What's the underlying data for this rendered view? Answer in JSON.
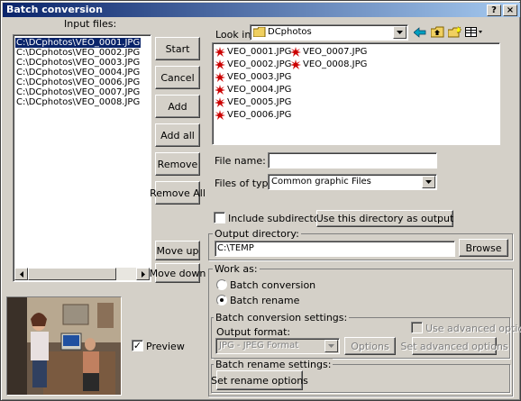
{
  "window": {
    "title": "Batch conversion",
    "help": "?",
    "close": "×"
  },
  "input_files": {
    "label": "Input files:",
    "items": [
      "C:\\DCphotos\\VEO_0001.JPG",
      "C:\\DCphotos\\VEO_0002.JPG",
      "C:\\DCphotos\\VEO_0003.JPG",
      "C:\\DCphotos\\VEO_0004.JPG",
      "C:\\DCphotos\\VEO_0006.JPG",
      "C:\\DCphotos\\VEO_0007.JPG",
      "C:\\DCphotos\\VEO_0008.JPG"
    ]
  },
  "buttons": {
    "start": "Start",
    "cancel": "Cancel",
    "add": "Add",
    "add_all": "Add all",
    "remove": "Remove",
    "remove_all": "Remove All",
    "move_up": "Move up",
    "move_down": "Move down",
    "use_dir": "Use this directory as output",
    "browse": "Browse",
    "options": "Options",
    "set_advanced": "Set advanced options",
    "set_rename": "Set rename options"
  },
  "look_in": {
    "label": "Look in:",
    "value": "DCphotos"
  },
  "files_col1": [
    "VEO_0001.JPG",
    "VEO_0002.JPG",
    "VEO_0003.JPG",
    "VEO_0004.JPG",
    "VEO_0005.JPG",
    "VEO_0006.JPG"
  ],
  "files_col2": [
    "VEO_0007.JPG",
    "VEO_0008.JPG"
  ],
  "file_name": {
    "label": "File name:",
    "value": ""
  },
  "files_of_type": {
    "label": "Files of type:",
    "value": "Common graphic Files"
  },
  "include_subdirs": {
    "label": "Include subdirectories",
    "checked": false
  },
  "output_dir": {
    "group_label": "Output directory:",
    "value": "C:\\TEMP"
  },
  "work_as": {
    "group_label": "Work as:",
    "options": [
      "Batch conversion",
      "Batch rename"
    ],
    "selected": "Batch rename"
  },
  "conversion_settings": {
    "group_label": "Batch conversion settings:",
    "output_format_label": "Output format:",
    "output_format_value": "JPG - JPEG Format",
    "use_advanced_label": "Use advanced options"
  },
  "rename_settings": {
    "group_label": "Batch rename settings:"
  },
  "preview": {
    "label": "Preview",
    "checked": true
  },
  "colors": {
    "selection": "#0a246a",
    "face": "#d4d0c8",
    "red_icon": "#cc0000"
  }
}
